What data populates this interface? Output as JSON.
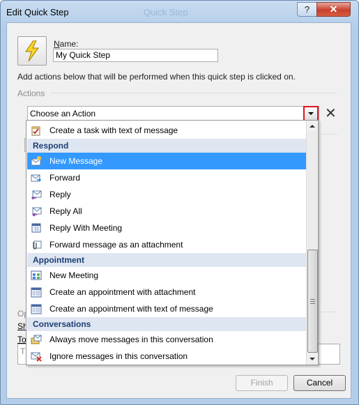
{
  "window": {
    "title": "Edit Quick Step",
    "ghost_title": "Quick Step",
    "help_glyph": "?",
    "close_glyph": "✕"
  },
  "form": {
    "name_label_prefix": "N",
    "name_label_rest": "ame:",
    "name_value": "My Quick Step",
    "description": "Add actions below that will be performed when this quick step is clicked on.",
    "actions_section_label": "Actions",
    "action_combo_value": "Choose an Action",
    "remove_action_glyph": "✕",
    "options_label_partial": "Op",
    "shortcut_label_partial": "Sh",
    "tooltip_label_partial": "To",
    "tooltip_text_partial": "Th"
  },
  "buttons": {
    "finish": "Finish",
    "cancel": "Cancel"
  },
  "dropdown": {
    "items": [
      {
        "type": "item",
        "label": "Create a task with text of message",
        "icon": "task-icon"
      },
      {
        "type": "group",
        "label": "Respond"
      },
      {
        "type": "item",
        "label": "New Message",
        "icon": "new-message-icon",
        "selected": true
      },
      {
        "type": "item",
        "label": "Forward",
        "icon": "forward-icon"
      },
      {
        "type": "item",
        "label": "Reply",
        "icon": "reply-icon"
      },
      {
        "type": "item",
        "label": "Reply All",
        "icon": "reply-all-icon"
      },
      {
        "type": "item",
        "label": "Reply With Meeting",
        "icon": "reply-meeting-icon"
      },
      {
        "type": "item",
        "label": "Forward message as an attachment",
        "icon": "attachment-icon"
      },
      {
        "type": "group",
        "label": "Appointment"
      },
      {
        "type": "item",
        "label": "New Meeting",
        "icon": "meeting-icon"
      },
      {
        "type": "item",
        "label": "Create an appointment with attachment",
        "icon": "calendar-icon"
      },
      {
        "type": "item",
        "label": "Create an appointment with text of message",
        "icon": "calendar-icon"
      },
      {
        "type": "group",
        "label": "Conversations"
      },
      {
        "type": "item",
        "label": "Always move messages in this conversation",
        "icon": "move-conversation-icon"
      },
      {
        "type": "item",
        "label": "Ignore messages in this conversation",
        "icon": "ignore-conversation-icon"
      }
    ],
    "scroll_position_fraction": 0.6
  },
  "colors": {
    "selection": "#3399ff",
    "group_header_bg": "#dde6f1",
    "group_header_text": "#1e3e73",
    "highlight_border": "#e2141e"
  }
}
